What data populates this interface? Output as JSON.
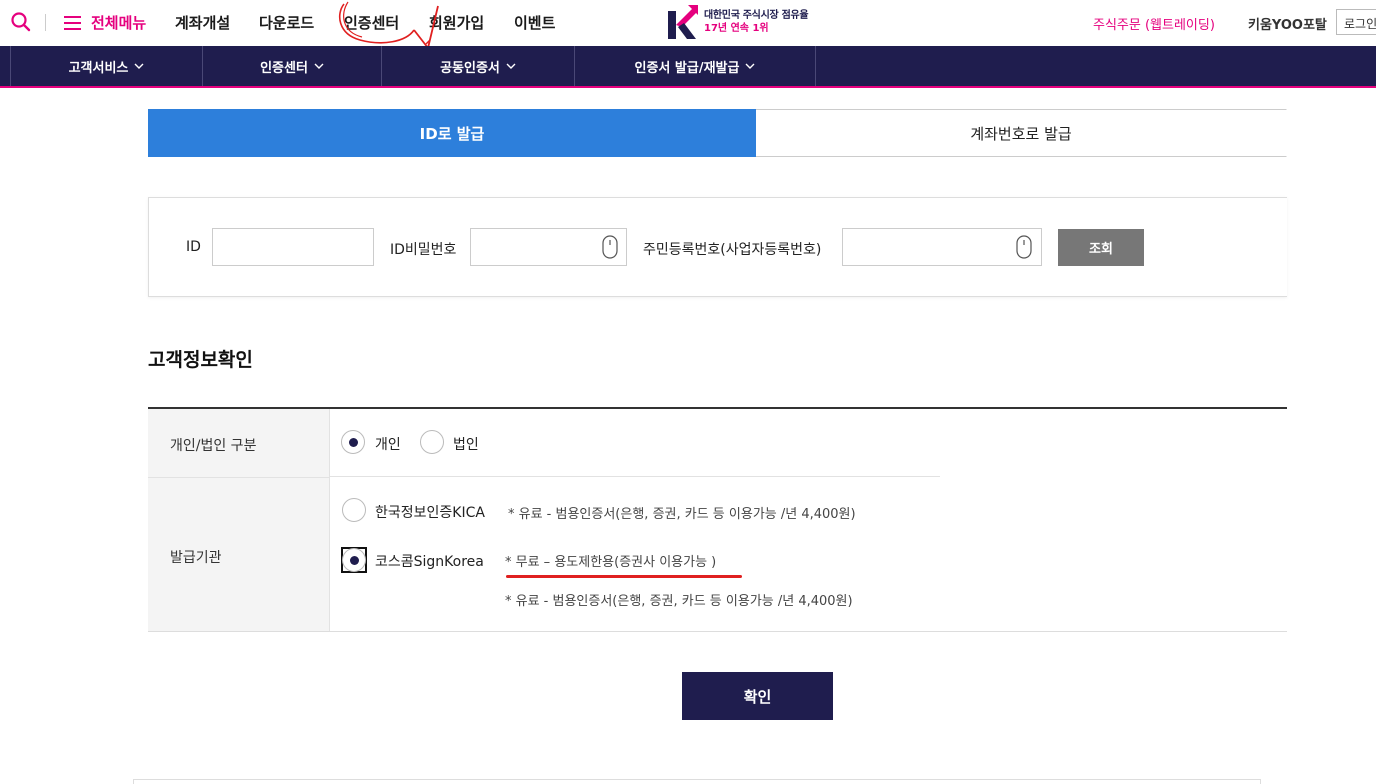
{
  "header": {
    "menu_all": "전체메뉴",
    "gnb": [
      "계좌개설",
      "다운로드",
      "인증센터",
      "회원가입",
      "이벤트"
    ],
    "logo_line1": "대한민국 주식시장 점유율",
    "logo_line2": "17년 연속 1위",
    "stock_order": "주식주문 (웹트레이딩)",
    "portal": "키움YOO포탈",
    "login": "로그인"
  },
  "nav": [
    "고객서비스",
    "인증센터",
    "공동인증서",
    "인증서 발급/재발급"
  ],
  "tabs": {
    "active": "ID로 발급",
    "inactive": "계좌번호로 발급"
  },
  "search": {
    "id_label": "ID",
    "pw_label": "ID비밀번호",
    "rrn_label": "주민등록번호(사업자등록번호)",
    "lookup": "조회"
  },
  "section_title": "고객정보확인",
  "form": {
    "type_label": "개인/법인 구분",
    "type_options": [
      "개인",
      "법인"
    ],
    "type_selected": "개인",
    "issuer_label": "발급기관",
    "issuers": [
      {
        "name": "한국정보인증KICA",
        "notes": [
          "* 유료 - 범용인증서(은행, 증권, 카드 등 이용가능 /년 4,400원)"
        ]
      },
      {
        "name": "코스콤SignKorea",
        "notes": [
          "* 무료 – 용도제한용(증권사 이용가능 )",
          "* 유료 - 범용인증서(은행, 증권, 카드 등 이용가능 /년 4,400원)"
        ]
      }
    ],
    "issuer_selected": "코스콤SignKorea"
  },
  "confirm": "확인",
  "colors": {
    "brand_pink": "#e5007e",
    "navy": "#1f1d4e",
    "tab_blue": "#2d7fdb",
    "annotation_red": "#e02020"
  }
}
